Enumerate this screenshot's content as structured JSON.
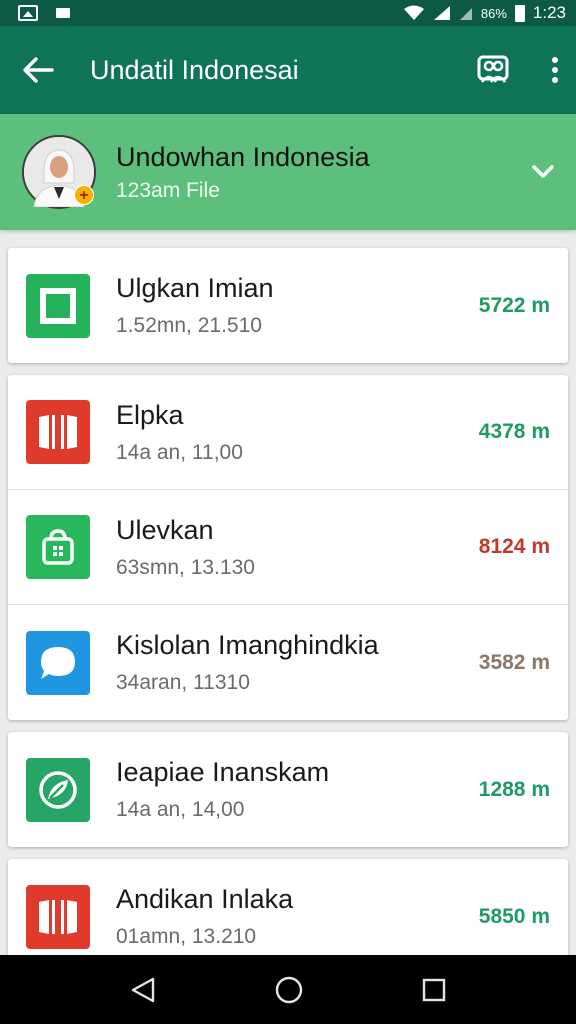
{
  "status_bar": {
    "battery_percent": "86%",
    "time": "1:23"
  },
  "app_bar": {
    "title": "Undatil Indonesai",
    "back_icon": "arrow-left-icon",
    "contacts_icon": "people-icon",
    "menu_icon": "more-vert-icon"
  },
  "contact": {
    "name": "Undowhan Indonesia",
    "subtitle": "123am File",
    "badge": "+"
  },
  "cards": [
    {
      "rows": [
        {
          "title": "Ulgkan Imian",
          "sub": "1.52mn, 21.510",
          "value": "5722 m",
          "value_color": "#1f9a63",
          "icon": "square-icon",
          "icon_bg": "#24b35a"
        }
      ]
    },
    {
      "rows": [
        {
          "title": "Elpka",
          "sub": "14a an, 11,00",
          "value": "4378 m",
          "value_color": "#1f9a63",
          "icon": "book-icon",
          "icon_bg": "#e03a2c"
        },
        {
          "title": "Ulevkan",
          "sub": "63smn, 13.130",
          "value": "8124 m",
          "value_color": "#c0392b",
          "icon": "bag-icon",
          "icon_bg": "#28b75a"
        },
        {
          "title": "Kislolan Imanghindkia",
          "sub": "34aran, 11310",
          "value": "3582 m",
          "value_color": "#8a7768",
          "icon": "chat-icon",
          "icon_bg": "#2196e0"
        }
      ]
    },
    {
      "rows": [
        {
          "title": "Ieapiae Inanskam",
          "sub": "14a an, 14,00",
          "value": "1288 m",
          "value_color": "#1f9a63",
          "icon": "leaf-icon",
          "icon_bg": "#25a566"
        }
      ]
    },
    {
      "rows": [
        {
          "title": "Andikan Inlaka",
          "sub": "01amn, 13.210",
          "value": "5850 m",
          "value_color": "#1f9a63",
          "icon": "book-icon",
          "icon_bg": "#e03a2c"
        }
      ]
    }
  ],
  "nav_bar": {
    "back_icon": "nav-back-icon",
    "home_icon": "nav-home-icon",
    "recents_icon": "nav-recents-icon"
  }
}
